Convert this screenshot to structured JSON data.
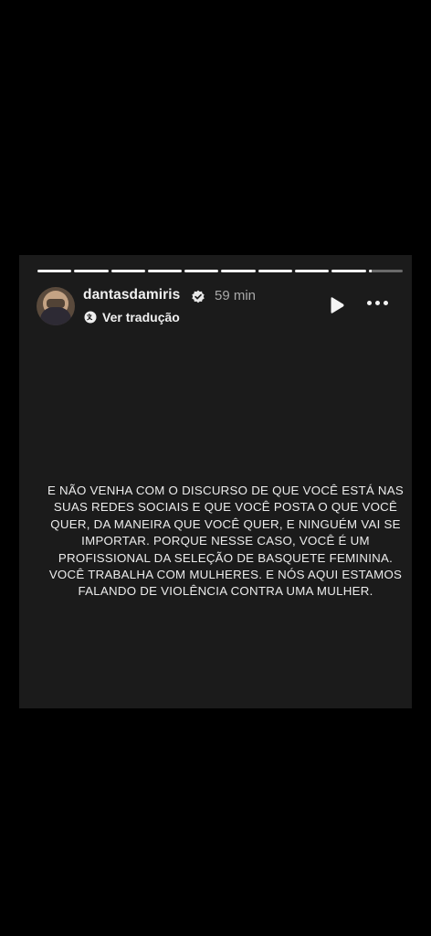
{
  "story": {
    "progress_segments": [
      1,
      1,
      1,
      1,
      1,
      1,
      1,
      1,
      1,
      0.1
    ],
    "username": "dantasdamiris",
    "verified": true,
    "time": "59 min",
    "translate_label": "Ver tradução",
    "icons": {
      "translate": "translate-icon",
      "play": "play-icon",
      "more": "more-options-icon",
      "verified": "verified-badge-icon"
    },
    "caption_lines": [
      "E NÃO VENHA COM O DISCURSO DE QUE VOCÊ ESTÁ NAS",
      "SUAS REDES SOCIAIS E QUE VOCÊ POSTA O QUE VOCÊ",
      "QUER, DA MANEIRA QUE VOCÊ QUER, E NINGUÉM VAI SE",
      "IMPORTAR. PORQUE NESSE CASO, VOCÊ É UM",
      "PROFISSIONAL DA SELEÇÃO DE BASQUETE FEMININA.",
      "VOCÊ TRABALHA COM MULHERES. E NÓS AQUI ESTAMOS",
      "FALANDO DE VIOLÊNCIA CONTRA UMA MULHER."
    ]
  }
}
